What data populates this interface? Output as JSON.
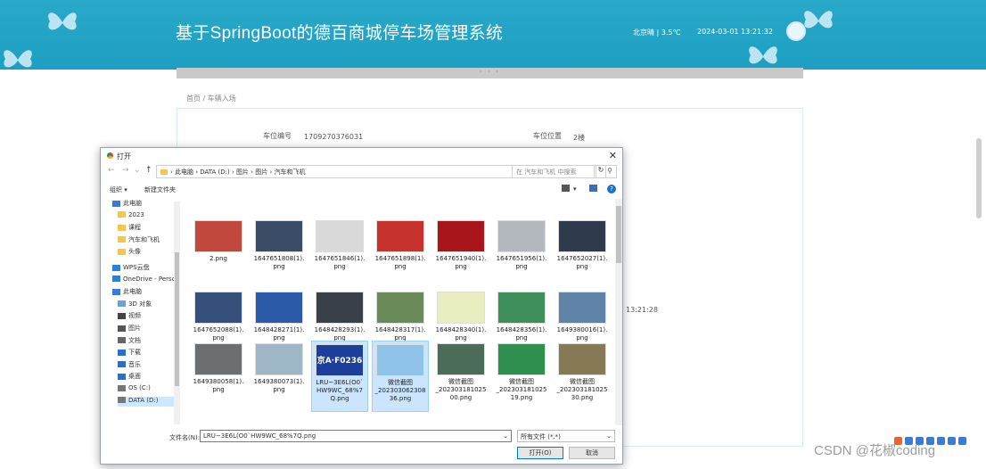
{
  "app": {
    "title": "基于SpringBoot的德百商城停车场管理系统",
    "weather": "北京晴 | 3.5℃",
    "datetime": "2024-03-01  13:21:32"
  },
  "collapse_handle": "· · ·",
  "breadcrumb": "首页  /  车辆入场",
  "form": {
    "slot_number_label": "车位编号",
    "slot_number_value": "1709270376031",
    "slot_location_label": "车位位置",
    "slot_location_value": "2楼",
    "time_fragment": "13:21:28"
  },
  "dialog": {
    "title": "打开",
    "address_path": "› 此电脑 › DATA (D:) › 图片 › 图片 › 汽车和飞机",
    "search_placeholder": "在 汽车和飞机 中搜索",
    "toolbar": {
      "organize": "组织 ▾",
      "new_folder": "新建文件夹"
    },
    "nav_items": [
      {
        "label": "此电脑",
        "icon": "computer-icon"
      },
      {
        "label": "2023",
        "icon": "folder-icon"
      },
      {
        "label": "课程",
        "icon": "folder-icon"
      },
      {
        "label": "汽车和飞机",
        "icon": "folder-icon"
      },
      {
        "label": "头像",
        "icon": "folder-icon"
      },
      {
        "label": "WPS云盘",
        "icon": "cloud-icon"
      },
      {
        "label": "OneDrive - Persc",
        "icon": "cloud-icon"
      },
      {
        "label": "此电脑",
        "icon": "computer-icon"
      },
      {
        "label": "3D 对象",
        "icon": "cube-icon"
      },
      {
        "label": "视频",
        "icon": "video-icon"
      },
      {
        "label": "图片",
        "icon": "image-icon"
      },
      {
        "label": "文档",
        "icon": "document-icon"
      },
      {
        "label": "下载",
        "icon": "download-icon"
      },
      {
        "label": "音乐",
        "icon": "music-icon"
      },
      {
        "label": "桌面",
        "icon": "desktop-icon"
      },
      {
        "label": "OS (C:)",
        "icon": "drive-icon"
      },
      {
        "label": "DATA (D:)",
        "icon": "drive-icon"
      }
    ],
    "files": [
      {
        "name": "2.png",
        "color": "#c0483d"
      },
      {
        "name": "1647651808(1).\npng",
        "color": "#3b4d66"
      },
      {
        "name": "1647651846(1).\npng",
        "color": "#d9d9d9"
      },
      {
        "name": "1647651898(1).\npng",
        "color": "#c8322c"
      },
      {
        "name": "1647651940(1).\npng",
        "color": "#a8161b"
      },
      {
        "name": "1647651956(1).\npng",
        "color": "#b3b8bf"
      },
      {
        "name": "1647652027(1).\npng",
        "color": "#2f3b4d"
      },
      {
        "name": "1647652088(1).\npng",
        "color": "#35507a"
      },
      {
        "name": "1648428271(1).\npng",
        "color": "#2b5aa8"
      },
      {
        "name": "1648428293(1).\npng",
        "color": "#3a4048"
      },
      {
        "name": "1648428317(1).\npng",
        "color": "#6a8a5a"
      },
      {
        "name": "1648428340(1).\npng",
        "color": "#e9eec0"
      },
      {
        "name": "1648428356(1).\npng",
        "color": "#3f8f5b"
      },
      {
        "name": "1649380016(1).\npng",
        "color": "#5f84a8"
      },
      {
        "name": "1649380058(1).\npng",
        "color": "#6b6f72"
      },
      {
        "name": "1649380073(1).\npng",
        "color": "#9fb6c7"
      },
      {
        "name": "LRU~3E6L(O0`\nHW9WC_68%7\nQ.png",
        "color": "#1d3f9c",
        "plate": "京A·F0236",
        "selected": true
      },
      {
        "name": "微信截图\n_202303062308\n36.png",
        "color": "#8fc3e8",
        "selected": true
      },
      {
        "name": "微信截图\n_202303181025\n00.png",
        "color": "#4c6c5a"
      },
      {
        "name": "微信截图\n_202303181025\n19.png",
        "color": "#2f8f4f"
      },
      {
        "name": "微信截图\n_202303181025\n30.png",
        "color": "#857a55"
      }
    ],
    "filename_label": "文件名(N):",
    "filename_value": "LRU~3E6L(O0`HW9WC_68%7Q.png",
    "filetype_value": "所有文件 (*.*)",
    "open_button": "打开(O)",
    "cancel_button": "取消"
  },
  "watermark": "CSDN @花椒coding"
}
